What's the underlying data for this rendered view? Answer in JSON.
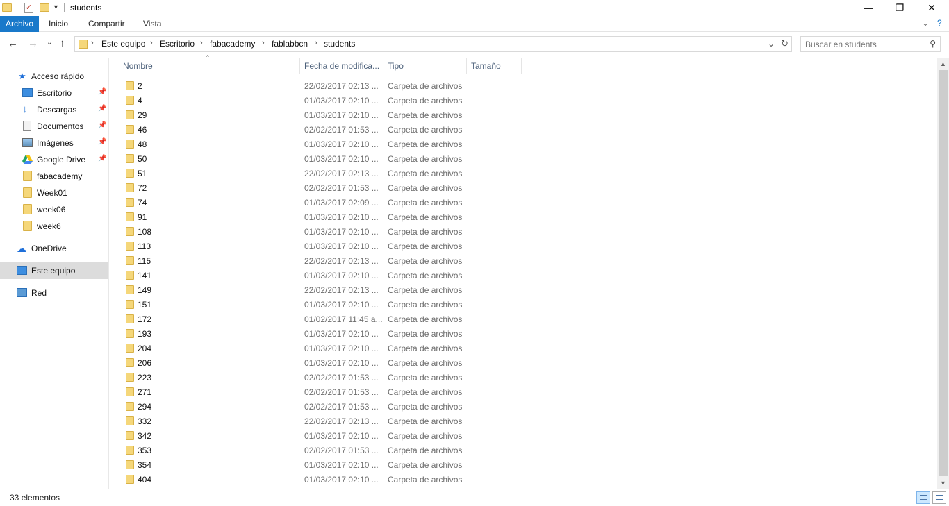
{
  "window": {
    "title": "students",
    "minimize_glyph": "—",
    "maximize_glyph": "❐",
    "close_glyph": "✕"
  },
  "ribbon": {
    "tabs": [
      "Archivo",
      "Inicio",
      "Compartir",
      "Vista"
    ]
  },
  "address": {
    "crumbs": [
      "Este equipo",
      "Escritorio",
      "fabacademy",
      "fablabbcn",
      "students"
    ]
  },
  "search": {
    "placeholder": "Buscar en students"
  },
  "nav": {
    "quick_access": "Acceso rápido",
    "items": [
      {
        "label": "Escritorio",
        "icon": "desktop-icon",
        "pinned": true
      },
      {
        "label": "Descargas",
        "icon": "download-icon",
        "pinned": true
      },
      {
        "label": "Documentos",
        "icon": "documents-icon",
        "pinned": true
      },
      {
        "label": "Imágenes",
        "icon": "images-icon",
        "pinned": true
      },
      {
        "label": "Google Drive",
        "icon": "google-drive-icon",
        "pinned": true
      },
      {
        "label": "fabacademy",
        "icon": "folder-icon",
        "pinned": false
      },
      {
        "label": "Week01",
        "icon": "folder-icon",
        "pinned": false
      },
      {
        "label": "week06",
        "icon": "folder-icon",
        "pinned": false
      },
      {
        "label": "week6",
        "icon": "folder-icon",
        "pinned": false
      }
    ],
    "onedrive": "OneDrive",
    "this_pc": "Este equipo",
    "network": "Red"
  },
  "columns": {
    "name": "Nombre",
    "date": "Fecha de modifica...",
    "type": "Tipo",
    "size": "Tamaño"
  },
  "files": [
    {
      "name": "2",
      "date": "22/02/2017 02:13 ...",
      "type": "Carpeta de archivos"
    },
    {
      "name": "4",
      "date": "01/03/2017 02:10 ...",
      "type": "Carpeta de archivos"
    },
    {
      "name": "29",
      "date": "01/03/2017 02:10 ...",
      "type": "Carpeta de archivos"
    },
    {
      "name": "46",
      "date": "02/02/2017 01:53 ...",
      "type": "Carpeta de archivos"
    },
    {
      "name": "48",
      "date": "01/03/2017 02:10 ...",
      "type": "Carpeta de archivos"
    },
    {
      "name": "50",
      "date": "01/03/2017 02:10 ...",
      "type": "Carpeta de archivos"
    },
    {
      "name": "51",
      "date": "22/02/2017 02:13 ...",
      "type": "Carpeta de archivos"
    },
    {
      "name": "72",
      "date": "02/02/2017 01:53 ...",
      "type": "Carpeta de archivos"
    },
    {
      "name": "74",
      "date": "01/03/2017 02:09 ...",
      "type": "Carpeta de archivos"
    },
    {
      "name": "91",
      "date": "01/03/2017 02:10 ...",
      "type": "Carpeta de archivos"
    },
    {
      "name": "108",
      "date": "01/03/2017 02:10 ...",
      "type": "Carpeta de archivos"
    },
    {
      "name": "113",
      "date": "01/03/2017 02:10 ...",
      "type": "Carpeta de archivos"
    },
    {
      "name": "115",
      "date": "22/02/2017 02:13 ...",
      "type": "Carpeta de archivos"
    },
    {
      "name": "141",
      "date": "01/03/2017 02:10 ...",
      "type": "Carpeta de archivos"
    },
    {
      "name": "149",
      "date": "22/02/2017 02:13 ...",
      "type": "Carpeta de archivos"
    },
    {
      "name": "151",
      "date": "01/03/2017 02:10 ...",
      "type": "Carpeta de archivos"
    },
    {
      "name": "172",
      "date": "01/02/2017 11:45 a...",
      "type": "Carpeta de archivos"
    },
    {
      "name": "193",
      "date": "01/03/2017 02:10 ...",
      "type": "Carpeta de archivos"
    },
    {
      "name": "204",
      "date": "01/03/2017 02:10 ...",
      "type": "Carpeta de archivos"
    },
    {
      "name": "206",
      "date": "01/03/2017 02:10 ...",
      "type": "Carpeta de archivos"
    },
    {
      "name": "223",
      "date": "02/02/2017 01:53 ...",
      "type": "Carpeta de archivos"
    },
    {
      "name": "271",
      "date": "02/02/2017 01:53 ...",
      "type": "Carpeta de archivos"
    },
    {
      "name": "294",
      "date": "02/02/2017 01:53 ...",
      "type": "Carpeta de archivos"
    },
    {
      "name": "332",
      "date": "22/02/2017 02:13 ...",
      "type": "Carpeta de archivos"
    },
    {
      "name": "342",
      "date": "01/03/2017 02:10 ...",
      "type": "Carpeta de archivos"
    },
    {
      "name": "353",
      "date": "02/02/2017 01:53 ...",
      "type": "Carpeta de archivos"
    },
    {
      "name": "354",
      "date": "01/03/2017 02:10 ...",
      "type": "Carpeta de archivos"
    },
    {
      "name": "404",
      "date": "01/03/2017 02:10 ...",
      "type": "Carpeta de archivos"
    }
  ],
  "status": {
    "count": "33 elementos"
  },
  "colors": {
    "accent": "#1979ca",
    "header_text": "#4c607a",
    "selected_nav": "#dcdcdc",
    "folder": "#f5d77a"
  }
}
